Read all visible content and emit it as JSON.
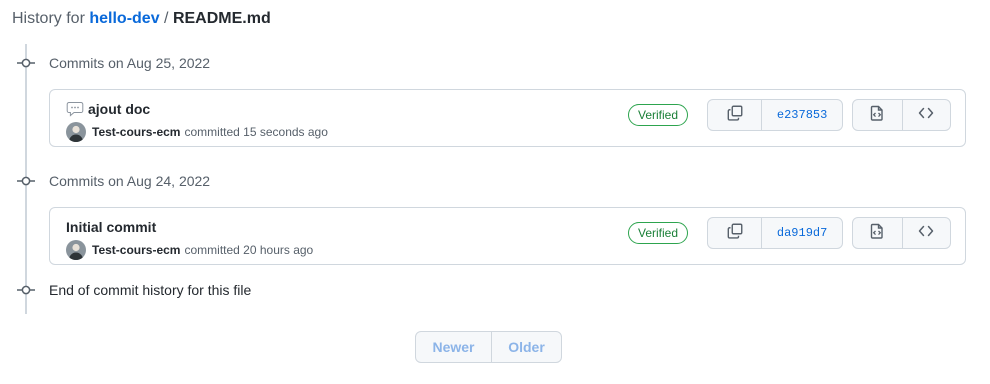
{
  "header": {
    "prefix": "History for",
    "repo": "hello-dev",
    "separator": "/",
    "file": "README.md"
  },
  "groups": [
    {
      "label": "Commits on Aug 25, 2022",
      "commit": {
        "message": "ajout doc",
        "author": "Test-cours-ecm",
        "time_text": "committed 15 seconds ago",
        "verified_label": "Verified",
        "sha": "e237853"
      }
    },
    {
      "label": "Commits on Aug 24, 2022",
      "commit": {
        "message": "Initial commit",
        "author": "Test-cours-ecm",
        "time_text": "committed 20 hours ago",
        "verified_label": "Verified",
        "sha": "da919d7"
      }
    }
  ],
  "end_label": "End of commit history for this file",
  "pagination": {
    "newer": "Newer",
    "older": "Older"
  },
  "icons": {
    "timeline": "git-commit-icon",
    "comment": "comment-bubble-icon",
    "copy": "copy-icon",
    "browse": "file-code-icon",
    "code": "code-icon"
  },
  "colors": {
    "link": "#0969da",
    "verified": "#1a7f37",
    "border": "#d0d7de",
    "muted": "#57606a"
  }
}
